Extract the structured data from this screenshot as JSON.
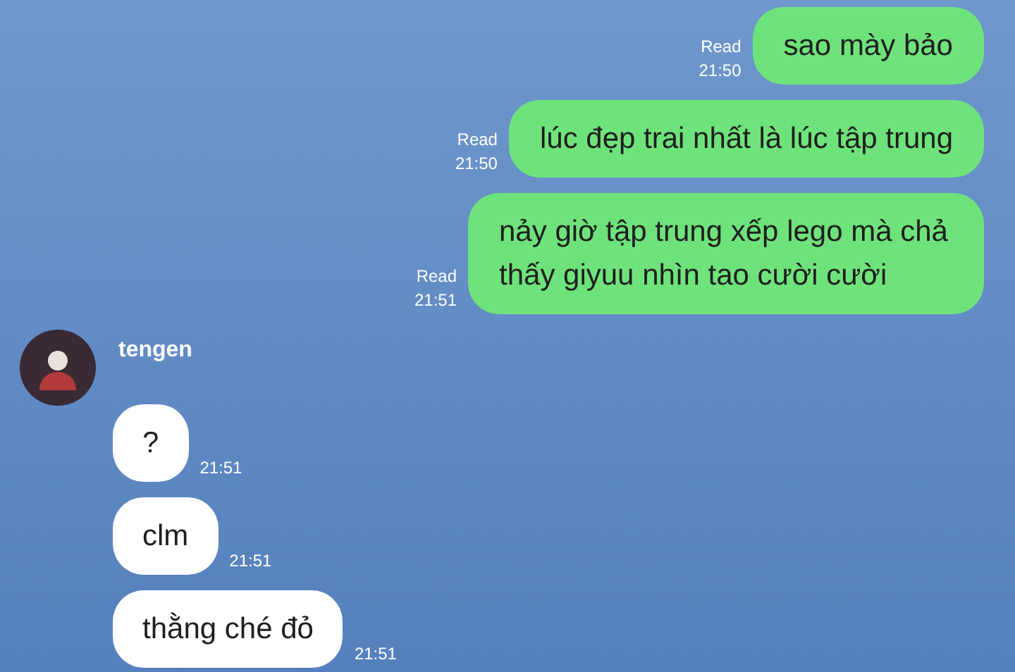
{
  "messages": [
    {
      "kind": "sent",
      "text": "sao mày bảo",
      "read": "Read",
      "time": "21:50"
    },
    {
      "kind": "sent",
      "text": "lúc đẹp trai nhất là lúc tập trung",
      "read": "Read",
      "time": "21:50"
    },
    {
      "kind": "sent",
      "text": "nảy giờ tập trung xếp lego mà chả thấy giyuu nhìn tao cười cười",
      "read": "Read",
      "time": "21:51"
    },
    {
      "kind": "sender",
      "name": "tengen"
    },
    {
      "kind": "received",
      "text": "?",
      "time": "21:51"
    },
    {
      "kind": "received",
      "text": "clm",
      "time": "21:51"
    },
    {
      "kind": "received",
      "text": "thằng ché đỏ",
      "time": "21:51"
    }
  ]
}
